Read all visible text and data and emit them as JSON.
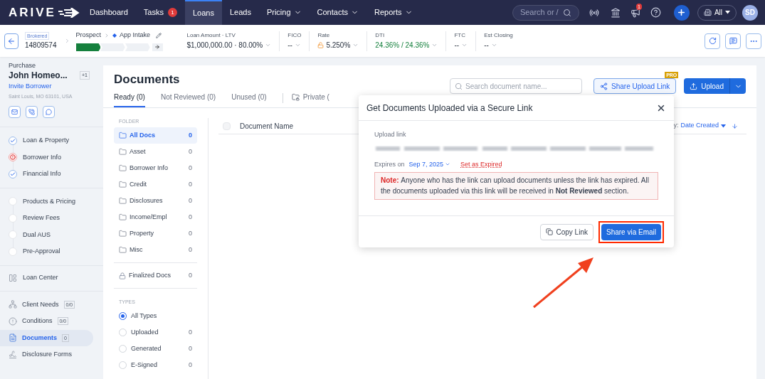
{
  "nav": {
    "logo": "ARIVE",
    "items": [
      {
        "label": "Dashboard",
        "selected": false,
        "menu": false
      },
      {
        "label": "Tasks",
        "selected": false,
        "menu": false,
        "badge": "1"
      },
      {
        "label": "Loans",
        "selected": true,
        "menu": false
      },
      {
        "label": "Leads",
        "selected": false,
        "menu": false
      },
      {
        "label": "Pricing",
        "selected": false,
        "menu": true
      },
      {
        "label": "Contacts",
        "selected": false,
        "menu": true
      },
      {
        "label": "Reports",
        "selected": false,
        "menu": true
      }
    ],
    "search_placeholder": "Search or /",
    "announcement_badge": "1",
    "workspace": "All",
    "avatar": "SD"
  },
  "loan_bar": {
    "channel": "Brokered",
    "loan_number": "14809574",
    "stage": "Prospect",
    "sub_stage": "App Intake",
    "progress": [
      {
        "done": true
      },
      {
        "done": false
      },
      {
        "done": false
      }
    ],
    "fields": [
      {
        "label": "Loan Amount · LTV",
        "value": "$1,000,000.00 · 80.00%",
        "kind": "plain"
      },
      {
        "label": "FICO",
        "value": "--",
        "kind": "plain"
      },
      {
        "label": "Rate",
        "value": "5.250%",
        "kind": "rate"
      },
      {
        "label": "DTI",
        "value": "24.36% / 24.36%",
        "kind": "positive"
      },
      {
        "label": "FTC",
        "value": "--",
        "kind": "plain"
      },
      {
        "label": "Est Closing",
        "value": "--",
        "kind": "plain"
      }
    ]
  },
  "borrower": {
    "loan_purpose": "Purchase",
    "name": "John Homeo...",
    "extra": "+1",
    "invite": "Invite Borrower",
    "address": "Saint Louis, MO 63101, USA"
  },
  "steps": [
    [
      {
        "label": "Loan & Property",
        "kind": "done"
      },
      {
        "label": "Borrower Info",
        "kind": "error"
      },
      {
        "label": "Financial Info",
        "kind": "done"
      }
    ],
    [
      {
        "label": "Products & Pricing",
        "kind": "todo"
      },
      {
        "label": "Review Fees",
        "kind": "todo"
      },
      {
        "label": "Dual AUS",
        "kind": "todo"
      },
      {
        "label": "Pre-Approval",
        "kind": "todo"
      }
    ]
  ],
  "loan_center": "Loan Center",
  "sections": [
    {
      "label": "Client Needs",
      "count": "0/0",
      "selected": false,
      "kind": "needs"
    },
    {
      "label": "Conditions",
      "count": "0/0",
      "selected": false,
      "kind": "conditions"
    },
    {
      "label": "Documents",
      "count": "0",
      "selected": true,
      "kind": "documents"
    },
    {
      "label": "Disclosure Forms",
      "selected": false,
      "kind": "forms"
    }
  ],
  "documents": {
    "title": "Documents",
    "tabs": [
      {
        "label": "Ready (0)",
        "selected": true
      },
      {
        "label": "Not Reviewed (0)",
        "selected": false
      },
      {
        "label": "Unused (0)",
        "selected": false
      }
    ],
    "private_tab": "Private (",
    "search_placeholder": "Search document name...",
    "share_button": "Share Upload Link",
    "pro_badge": "PRO",
    "upload_button": "Upload",
    "folder_heading": "FOLDER",
    "folders": [
      {
        "label": "All Docs",
        "count": "0",
        "selected": true
      },
      {
        "label": "Asset",
        "count": "0",
        "selected": false
      },
      {
        "label": "Borrower Info",
        "count": "0",
        "selected": false
      },
      {
        "label": "Credit",
        "count": "0",
        "selected": false
      },
      {
        "label": "Disclosures",
        "count": "0",
        "selected": false
      },
      {
        "label": "Income/Empl",
        "count": "0",
        "selected": false
      },
      {
        "label": "Property",
        "count": "0",
        "selected": false
      },
      {
        "label": "Misc",
        "count": "0",
        "selected": false
      }
    ],
    "finalized": {
      "label": "Finalized Docs",
      "count": "0"
    },
    "types_heading": "TYPES",
    "types": [
      {
        "label": "All Types",
        "selected": true
      },
      {
        "label": "Uploaded",
        "count": "0",
        "selected": false
      },
      {
        "label": "Generated",
        "count": "0",
        "selected": false
      },
      {
        "label": "E-Signed",
        "count": "0",
        "selected": false
      }
    ],
    "table": {
      "all_checked": false,
      "column": "Document Name",
      "sort_label": "y:",
      "sort_value": "Date Created"
    }
  },
  "modal": {
    "title": "Get Documents Uploaded via a Secure Link",
    "link_label": "Upload link",
    "expires_label": "Expires on",
    "expires_date": "Sep 7, 2025",
    "expire_action": "Set as Expired",
    "note_label": "Note:",
    "note": "Anyone who has the link can upload documents unless the link has expired. All the documents uploaded via this link will be received in **Not Reviewed** section.",
    "buttons": [
      {
        "label": "Copy Link",
        "kind": "secondary"
      },
      {
        "label": "Share via Email",
        "kind": "primary",
        "highlighted": true
      }
    ]
  }
}
